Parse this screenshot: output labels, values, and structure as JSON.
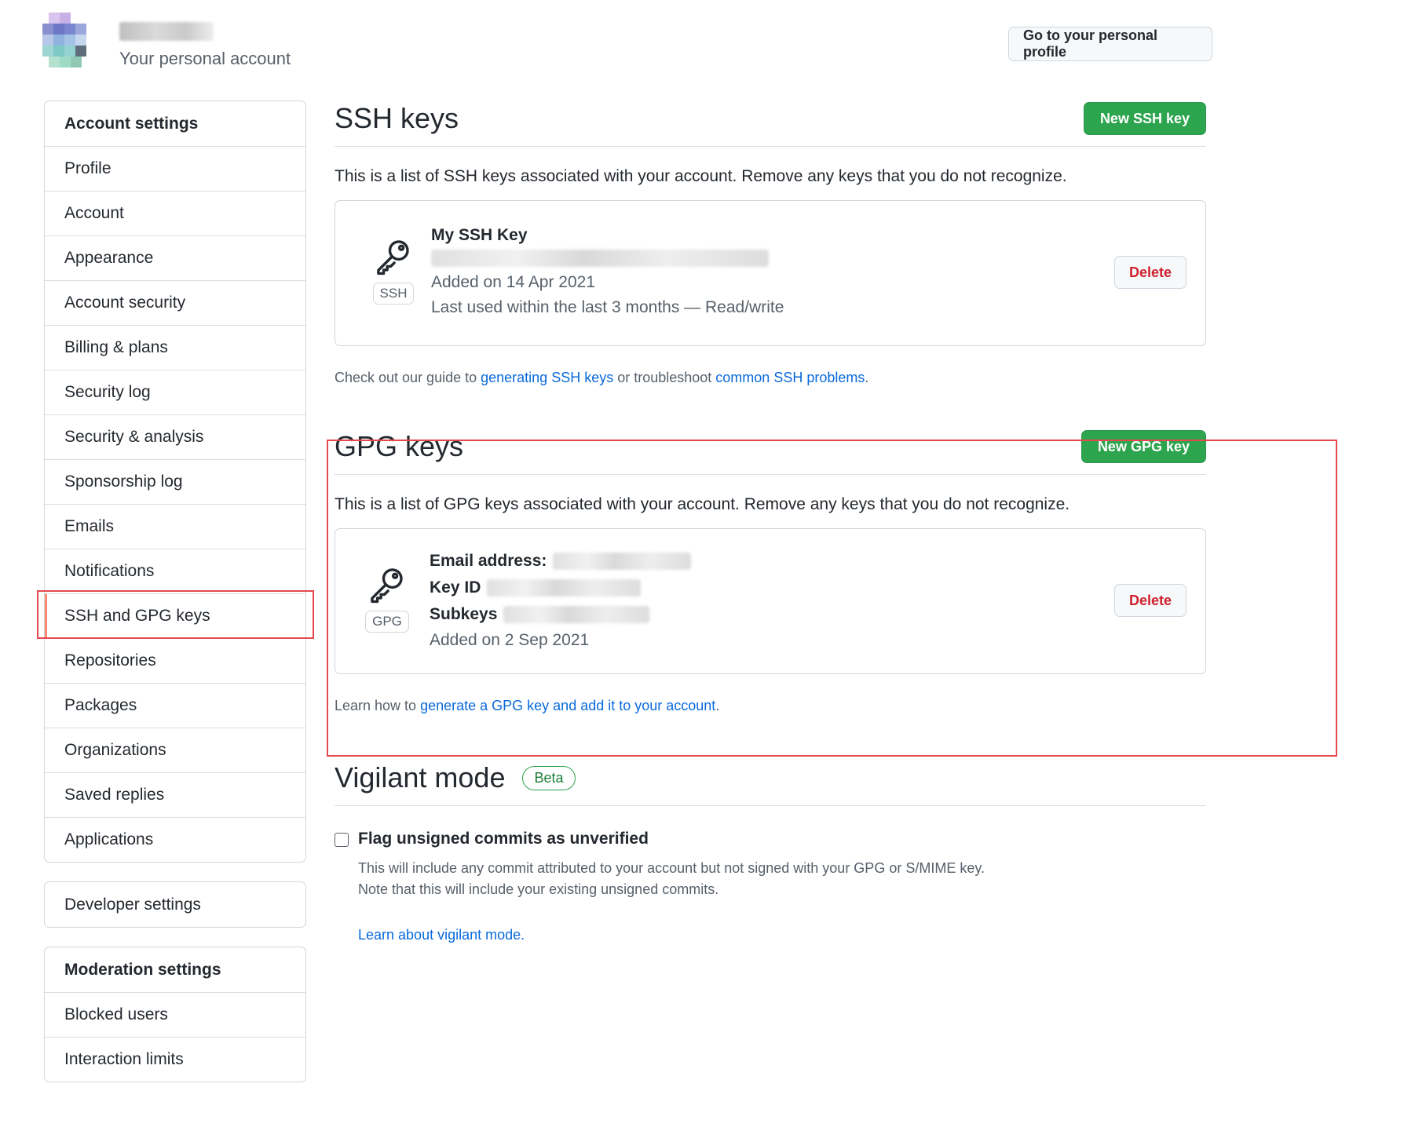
{
  "header": {
    "subtitle": "Your personal account",
    "profile_button": "Go to your personal profile"
  },
  "sidebar": {
    "account_menu": [
      {
        "label": "Account settings",
        "heading": true
      },
      {
        "label": "Profile"
      },
      {
        "label": "Account"
      },
      {
        "label": "Appearance"
      },
      {
        "label": "Account security"
      },
      {
        "label": "Billing & plans"
      },
      {
        "label": "Security log"
      },
      {
        "label": "Security & analysis"
      },
      {
        "label": "Sponsorship log"
      },
      {
        "label": "Emails"
      },
      {
        "label": "Notifications"
      },
      {
        "label": "SSH and GPG keys",
        "selected": true
      },
      {
        "label": "Repositories"
      },
      {
        "label": "Packages"
      },
      {
        "label": "Organizations"
      },
      {
        "label": "Saved replies"
      },
      {
        "label": "Applications"
      }
    ],
    "developer_settings": "Developer settings",
    "moderation_menu": [
      {
        "label": "Moderation settings",
        "heading": true
      },
      {
        "label": "Blocked users"
      },
      {
        "label": "Interaction limits"
      }
    ]
  },
  "ssh": {
    "title": "SSH keys",
    "new_button": "New SSH key",
    "description": "This is a list of SSH keys associated with your account. Remove any keys that you do not recognize.",
    "key": {
      "type_label": "SSH",
      "name": "My SSH Key",
      "added": "Added on 14 Apr 2021",
      "last_used": "Last used within the last 3 months — Read/write",
      "delete_label": "Delete"
    },
    "help": {
      "prefix": "Check out our guide to ",
      "link1": "generating SSH keys",
      "middle": " or troubleshoot ",
      "link2": "common SSH problems",
      "suffix": "."
    }
  },
  "gpg": {
    "title": "GPG keys",
    "new_button": "New GPG key",
    "description": "This is a list of GPG keys associated with your account. Remove any keys that you do not recognize.",
    "key": {
      "type_label": "GPG",
      "email_label": "Email address:",
      "keyid_label": "Key ID",
      "subkeys_label": "Subkeys",
      "added": "Added on 2 Sep 2021",
      "delete_label": "Delete"
    },
    "help": {
      "prefix": "Learn how to ",
      "link": "generate a GPG key and add it to your account",
      "suffix": "."
    }
  },
  "vigilant": {
    "title": "Vigilant mode",
    "badge": "Beta",
    "checkbox_label": "Flag unsigned commits as unverified",
    "note_line1": "This will include any commit attributed to your account but not signed with your GPG or S/MIME key.",
    "note_line2": "Note that this will include your existing unsigned commits.",
    "learn_link": "Learn about vigilant mode."
  }
}
